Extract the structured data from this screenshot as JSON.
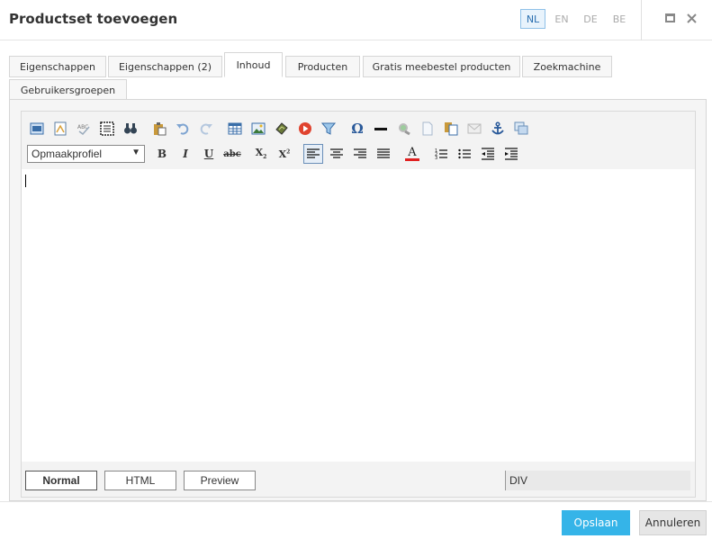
{
  "dialog": {
    "title": "Productset toevoegen",
    "languages": [
      "NL",
      "EN",
      "DE",
      "BE"
    ],
    "active_language": "NL"
  },
  "tabs": [
    {
      "label": "Eigenschappen"
    },
    {
      "label": "Eigenschappen (2)"
    },
    {
      "label": "Inhoud",
      "active": true
    },
    {
      "label": "Producten"
    },
    {
      "label": "Gratis meebestel producten"
    },
    {
      "label": "Zoekmachine"
    },
    {
      "label": "Gebruikersgroepen"
    }
  ],
  "editor": {
    "style_select": "Opmaakprofiel",
    "modes": [
      "Normal",
      "HTML",
      "Preview"
    ],
    "active_mode": "Normal",
    "path": "DIV",
    "icons_row1": [
      "source-icon",
      "template-icon",
      "spellcheck-icon",
      "select-all-icon",
      "find-icon",
      "paste-icon",
      "undo-icon",
      "redo-icon",
      "table-icon",
      "image-icon",
      "media-icon",
      "play-icon",
      "filter-icon",
      "omega-icon",
      "horizontal-rule-icon",
      "link-icon",
      "document-icon",
      "copy-icon",
      "email-icon",
      "anchor-icon",
      "window-icon"
    ],
    "icons_row2": [
      "bold-icon",
      "italic-icon",
      "underline-icon",
      "strikethrough-icon",
      "subscript-icon",
      "superscript-icon",
      "align-left-icon",
      "align-center-icon",
      "align-right-icon",
      "justify-icon",
      "font-color-icon",
      "ordered-list-icon",
      "unordered-list-icon",
      "outdent-icon",
      "indent-icon"
    ],
    "labels": {
      "bold": "B",
      "italic": "I",
      "underline": "U",
      "strike": "abc",
      "sub": "X",
      "sup": "X",
      "font_color": "A",
      "omega": "Ω"
    },
    "colors": {
      "accent": "#35b4e8",
      "font_color_bar": "#e02020",
      "play": "#e0432f"
    }
  },
  "footer": {
    "save_label": "Opslaan",
    "cancel_label": "Annuleren"
  }
}
